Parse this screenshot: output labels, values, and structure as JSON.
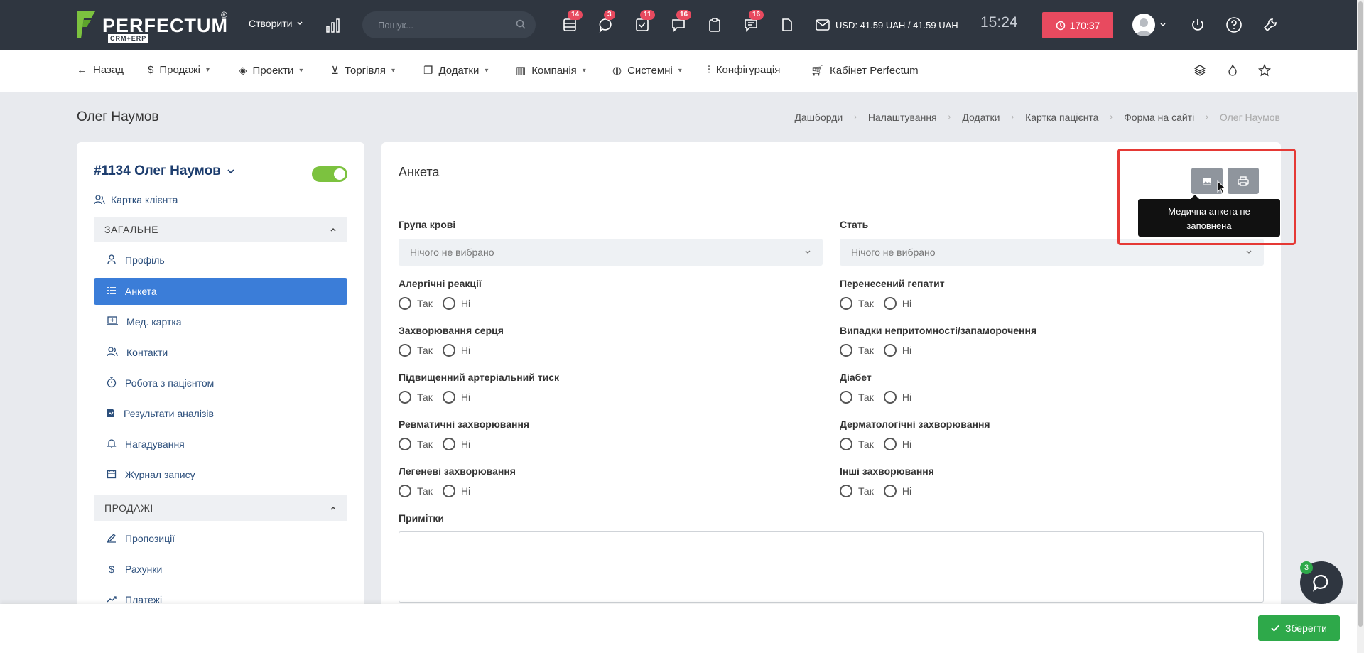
{
  "header": {
    "logo_text": "PERFECTUM",
    "logo_sub": "CRM+ERP",
    "logo_reg": "®",
    "create_label": "Створити",
    "search_placeholder": "Пошук...",
    "badges": {
      "b1": "14",
      "b2": "3",
      "b3": "11",
      "b4": "16",
      "b5": "16"
    },
    "currency": "USD: 41.59 UAH / 41.59 UAH",
    "time": "15:24",
    "timer": "170:37"
  },
  "nav": {
    "back": "Назад",
    "sales": "Продажі",
    "projects": "Проекти",
    "trade": "Торгівля",
    "addons": "Додатки",
    "company": "Компанія",
    "system": "Системні",
    "config": "Конфігурація",
    "cabinet": "Кабінет Perfectum"
  },
  "page": {
    "title": "Олег Наумов",
    "breadcrumbs": [
      "Дашборди",
      "Налаштування",
      "Додатки",
      "Картка пацієнта",
      "Форма на сайті",
      "Олег Наумов"
    ]
  },
  "sidebar": {
    "client_title": "#1134 Олег Наумов",
    "client_card": "Картка клієнта",
    "section_general": "ЗАГАЛЬНЕ",
    "items": [
      {
        "label": "Профіль"
      },
      {
        "label": "Анкета"
      },
      {
        "label": "Мед. картка"
      },
      {
        "label": "Контакти"
      },
      {
        "label": "Робота з пацієнтом"
      },
      {
        "label": "Результати аналізів"
      },
      {
        "label": "Нагадування"
      },
      {
        "label": "Журнал запису"
      }
    ],
    "section_sales": "ПРОДАЖІ",
    "sales_items": [
      {
        "label": "Пропозиції"
      },
      {
        "label": "Рахунки"
      },
      {
        "label": "Платежі"
      }
    ]
  },
  "form": {
    "title": "Анкета",
    "tooltip": "Медична анкета не заповнена",
    "blood_group_label": "Група крові",
    "blood_group_value": "Нічого не вибрано",
    "sex_label": "Стать",
    "sex_value": "Нічого не вибрано",
    "yes": "Так",
    "no": "Ні",
    "questions_left": [
      "Алергічні реакції",
      "Захворювання серця",
      "Підвищенний артеріальний тиск",
      "Ревматичні захворювання",
      "Легеневі захворювання"
    ],
    "questions_right": [
      "Перенесений гепатит",
      "Випадки непритомності/запаморочення",
      "Діабет",
      "Дерматологічні захворювання",
      "Інші захворювання"
    ],
    "notes_label": "Примітки"
  },
  "footer": {
    "save": "Зберегти",
    "chat_badge": "3"
  },
  "colors": {
    "header_bg": "#2f3640",
    "accent_blue": "#3b7dd8",
    "timer_red": "#e84a5f",
    "save_green": "#2ea94a",
    "toggle_green": "#7cc23f",
    "highlight_red": "#e53935"
  }
}
